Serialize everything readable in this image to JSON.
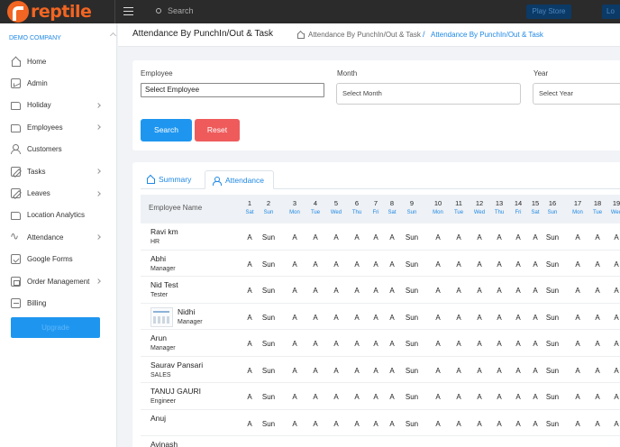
{
  "brand": {
    "logo_text": "reptile",
    "logo_color": "#f26522"
  },
  "topbar": {
    "search_placeholder": "Search",
    "playstore_label": "Play Store",
    "right_button_label": "Lo"
  },
  "sidebar": {
    "company": "DEMO COMPANY",
    "items": [
      {
        "label": "Home",
        "icon": "home-icon",
        "has_submenu": false
      },
      {
        "label": "Admin",
        "icon": "chart-icon",
        "has_submenu": false
      },
      {
        "label": "Holiday",
        "icon": "folder-icon",
        "has_submenu": true
      },
      {
        "label": "Employees",
        "icon": "folder-icon",
        "has_submenu": true
      },
      {
        "label": "Customers",
        "icon": "users-icon",
        "has_submenu": false
      },
      {
        "label": "Tasks",
        "icon": "edit-icon",
        "has_submenu": true
      },
      {
        "label": "Leaves",
        "icon": "edit-icon",
        "has_submenu": true
      },
      {
        "label": "Location Analytics",
        "icon": "folder-icon",
        "has_submenu": false
      },
      {
        "label": "Attendance",
        "icon": "pulse-icon",
        "has_submenu": true
      },
      {
        "label": "Google Forms",
        "icon": "check-icon",
        "has_submenu": false
      },
      {
        "label": "Order Management",
        "icon": "cart-icon",
        "has_submenu": true
      },
      {
        "label": "Billing",
        "icon": "bill-icon",
        "has_submenu": false
      }
    ],
    "bottom_button": "Upgrade"
  },
  "header": {
    "title": "Attendance By PunchIn/Out & Task",
    "breadcrumb": [
      "Attendance By PunchIn/Out & Task",
      "Attendance By PunchIn/Out & Task"
    ],
    "breadcrumb_sep": "/"
  },
  "filters": {
    "employee_label": "Employee",
    "employee_value": "Select Employee",
    "month_label": "Month",
    "month_value": "Select Month",
    "year_label": "Year",
    "year_value": "Select Year",
    "search_button": "Search",
    "reset_button": "Reset"
  },
  "tabs": {
    "summary": "Summary",
    "attendance": "Attendance"
  },
  "table": {
    "employee_col": "Employee Name",
    "days": [
      {
        "num": "1",
        "name": "Sat"
      },
      {
        "num": "2",
        "name": "Sun"
      },
      {
        "num": "3",
        "name": "Mon"
      },
      {
        "num": "4",
        "name": "Tue"
      },
      {
        "num": "5",
        "name": "Wed"
      },
      {
        "num": "6",
        "name": "Thu"
      },
      {
        "num": "7",
        "name": "Fri"
      },
      {
        "num": "8",
        "name": "Sat"
      },
      {
        "num": "9",
        "name": "Sun"
      },
      {
        "num": "10",
        "name": "Mon"
      },
      {
        "num": "11",
        "name": "Tue"
      },
      {
        "num": "12",
        "name": "Wed"
      },
      {
        "num": "13",
        "name": "Thu"
      },
      {
        "num": "14",
        "name": "Fri"
      },
      {
        "num": "15",
        "name": "Sat"
      },
      {
        "num": "16",
        "name": "Sun"
      },
      {
        "num": "17",
        "name": "Mon"
      },
      {
        "num": "18",
        "name": "Tue"
      },
      {
        "num": "19",
        "name": "Wed"
      }
    ],
    "rows": [
      {
        "name": "Ravi km",
        "role": "HR",
        "avatar": false
      },
      {
        "name": "Abhi",
        "role": "Manager",
        "avatar": false
      },
      {
        "name": "Nid Test",
        "role": "Tester",
        "avatar": false
      },
      {
        "name": "Nidhi",
        "role": "Manager",
        "avatar": true
      },
      {
        "name": "Arun",
        "role": "Manager",
        "avatar": false
      },
      {
        "name": "Saurav Pansari",
        "role": "SALES",
        "avatar": false
      },
      {
        "name": "TANUJ GAURI",
        "role": "Engineer",
        "avatar": false
      },
      {
        "name": "Anuj",
        "role": "",
        "avatar": false
      },
      {
        "name": "Avinash",
        "role": "",
        "avatar": false
      }
    ],
    "pattern": [
      "A",
      "Sun",
      "A",
      "A",
      "A",
      "A",
      "A",
      "A",
      "Sun",
      "A",
      "A",
      "A",
      "A",
      "A",
      "A",
      "Sun",
      "A",
      "A",
      "A"
    ]
  }
}
